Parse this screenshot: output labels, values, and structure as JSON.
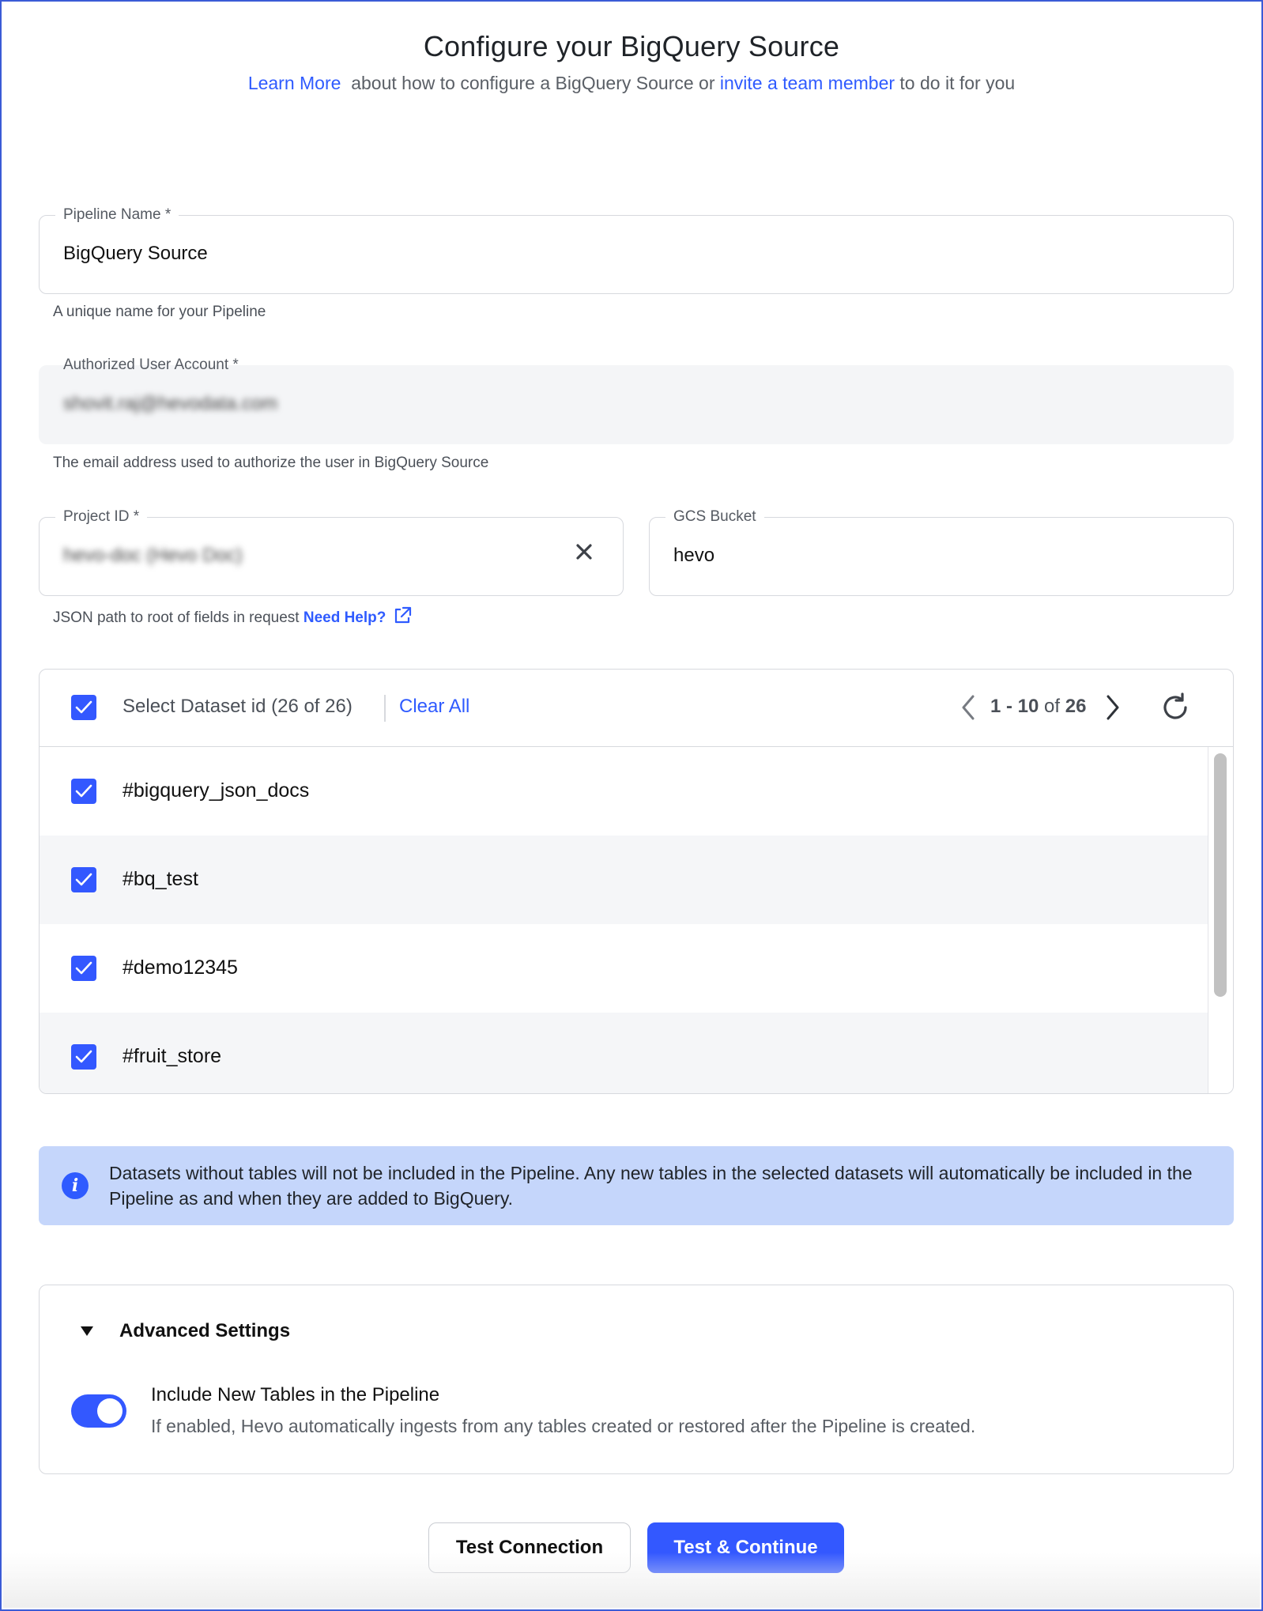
{
  "header": {
    "title": "Configure your BigQuery Source",
    "learn_more": "Learn More",
    "subtitle_mid": "about how to configure a BigQuery Source or",
    "invite_link": "invite a team member",
    "subtitle_end": "to do it for you"
  },
  "pipeline_name": {
    "label": "Pipeline Name *",
    "value": "BigQuery Source",
    "hint": "A unique name for your Pipeline"
  },
  "authorized_user": {
    "label": "Authorized User Account *",
    "value": "shovit.raj@hevodata.com",
    "hint": "The email address used to authorize the user in BigQuery Source"
  },
  "project_id": {
    "label": "Project ID *",
    "value": "hevo-doc (Hevo Doc)"
  },
  "gcs_bucket": {
    "label": "GCS Bucket",
    "value": "hevo"
  },
  "json_hint": {
    "text": "JSON path to root of fields in request",
    "link": "Need Help?"
  },
  "datasets": {
    "title": "Select Dataset id (26 of 26)",
    "clear_all": "Clear All",
    "pager_range": "1 - 10",
    "pager_of": "of",
    "pager_total": "26",
    "items": [
      {
        "name": "#bigquery_json_docs",
        "checked": true
      },
      {
        "name": "#bq_test",
        "checked": true
      },
      {
        "name": "#demo12345",
        "checked": true
      },
      {
        "name": "#fruit_store",
        "checked": true
      }
    ]
  },
  "info": {
    "text": "Datasets without tables will not be included in the Pipeline. Any new tables in the selected datasets will automatically be included in the Pipeline as and when they are added to BigQuery."
  },
  "advanced": {
    "title": "Advanced Settings",
    "toggle_title": "Include New Tables in the Pipeline",
    "toggle_desc": "If enabled, Hevo automatically ingests from any tables created or restored after the Pipeline is created.",
    "toggle_on": true
  },
  "buttons": {
    "test_connection": "Test Connection",
    "test_continue": "Test & Continue"
  },
  "colors": {
    "accent": "#3358ff",
    "link": "#2f5bff",
    "info_bg": "#c5d6fb"
  }
}
